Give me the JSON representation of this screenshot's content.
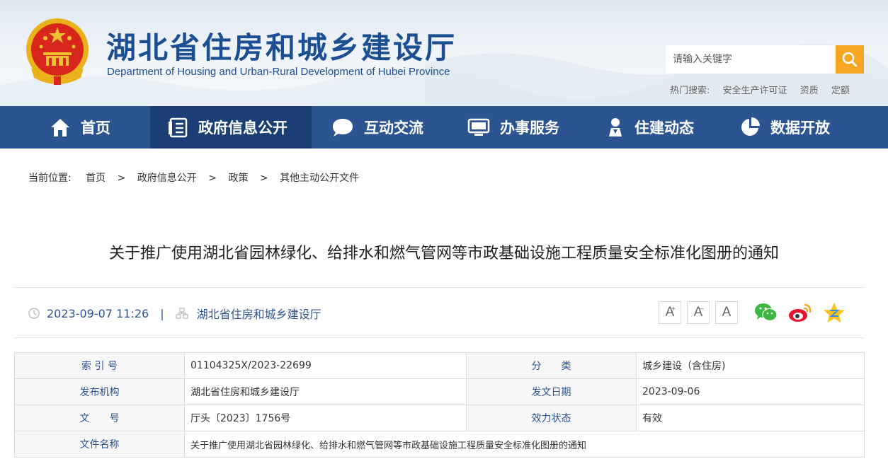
{
  "header": {
    "title_cn": "湖北省住房和城乡建设厅",
    "title_en": "Department of Housing and Urban-Rural Development of Hubei Province",
    "search_placeholder": "请输入关键字",
    "hot_label": "热门搜索:",
    "hot_items": [
      "安全生产许可证",
      "资质",
      "定额"
    ]
  },
  "nav": {
    "items": [
      {
        "label": "首页",
        "icon": "home-icon"
      },
      {
        "label": "政府信息公开",
        "icon": "document-list-icon"
      },
      {
        "label": "互动交流",
        "icon": "chat-bubble-icon"
      },
      {
        "label": "办事服务",
        "icon": "monitor-icon"
      },
      {
        "label": "住建动态",
        "icon": "location-person-icon"
      },
      {
        "label": "数据开放",
        "icon": "pie-chart-icon"
      }
    ],
    "active_index": 1
  },
  "breadcrumb": {
    "lead": "当前位置:",
    "items": [
      "首页",
      "政府信息公开",
      "政策",
      "其他主动公开文件"
    ],
    "sep": ">"
  },
  "article": {
    "title": "关于推广使用湖北省园林绿化、给排水和燃气管网等市政基础设施工程质量安全标准化图册的通知",
    "datetime": "2023-09-07 11:26",
    "divider": "|",
    "source": "湖北省住房和城乡建设厅"
  },
  "font_buttons": [
    "A",
    "A",
    "A"
  ],
  "share": [
    "wechat-icon",
    "weibo-icon",
    "qzone-icon"
  ],
  "info": {
    "rows": [
      [
        {
          "k": "索 引 号",
          "v": "01104325X/2023-22699"
        },
        {
          "k": "分　　类",
          "v": "城乡建设（含住房)"
        }
      ],
      [
        {
          "k": "发布机构",
          "v": "湖北省住房和城乡建设厅"
        },
        {
          "k": "发文日期",
          "v": "2023-09-06"
        }
      ],
      [
        {
          "k": "文　　号",
          "v": "厅头〔2023〕1756号"
        },
        {
          "k": "效力状态",
          "v": "有效"
        }
      ]
    ],
    "name_key": "文件名称",
    "name_value": "关于推广使用湖北省园林绿化、给排水和燃气管网等市政基础设施工程质量安全标准化图册的通知"
  },
  "colors": {
    "brand_blue": "#2c5491",
    "nav_active": "#1b3f74",
    "search_orange": "#f6a623",
    "emblem_red": "#d8261c",
    "emblem_gold": "#f2c233"
  }
}
